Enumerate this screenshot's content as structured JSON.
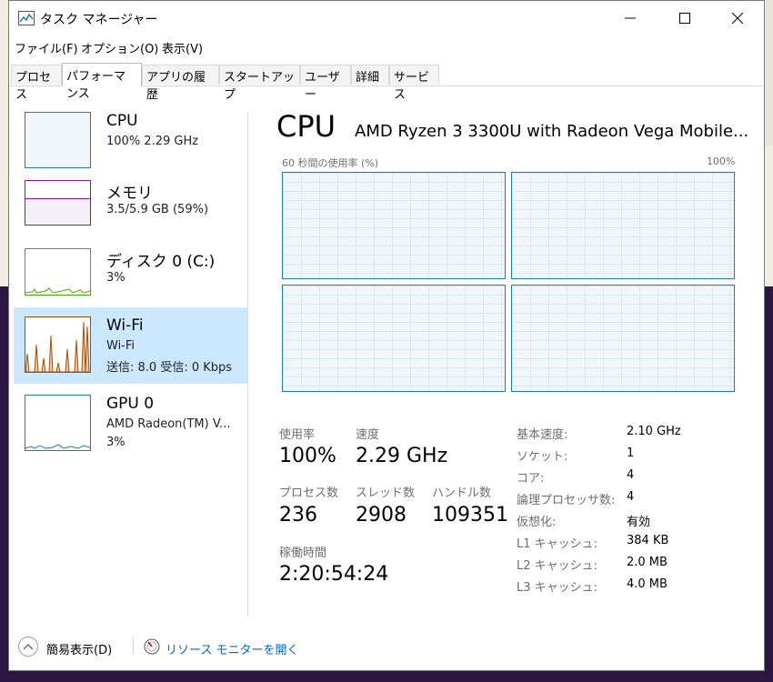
{
  "window": {
    "title": "タスク マネージャー",
    "controls": {
      "minimize": "—",
      "maximize": "☐",
      "close": "✕"
    }
  },
  "menu": [
    "ファイル(F)",
    "オプション(O)",
    "表示(V)"
  ],
  "tabs": [
    {
      "label": "プロセス",
      "active": false
    },
    {
      "label": "パフォーマンス",
      "active": true
    },
    {
      "label": "アプリの履歴",
      "active": false
    },
    {
      "label": "スタートアップ",
      "active": false
    },
    {
      "label": "ユーザー",
      "active": false
    },
    {
      "label": "詳細",
      "active": false
    },
    {
      "label": "サービス",
      "active": false
    }
  ],
  "sidebar": [
    {
      "title": "CPU",
      "line1": "100%  2.29 GHz",
      "line2": "",
      "color": "#1f7bb0",
      "selected": false
    },
    {
      "title": "メモリ",
      "line1": "3.5/5.9 GB (59%)",
      "line2": "",
      "color": "#8b12ae",
      "selected": false,
      "fill_fraction": 0.59
    },
    {
      "title": "ディスク 0 (C:)",
      "line1": "3%",
      "line2": "",
      "color": "#4da60c",
      "selected": false
    },
    {
      "title": "Wi-Fi",
      "line1": "Wi-Fi",
      "line2": "送信: 8.0  受信: 0 Kbps",
      "color": "#a74f01",
      "selected": true
    },
    {
      "title": "GPU 0",
      "line1": "AMD Radeon(TM) V...",
      "line2": "3%",
      "color": "#1f7bb0",
      "selected": false
    }
  ],
  "detail": {
    "title": "CPU",
    "cpu_name": "AMD Ryzen 3 3300U with Radeon Vega Mobile...",
    "graph_left_label": "60 秒間の使用率 (%)",
    "graph_right_label": "100%",
    "stats": {
      "usage_label": "使用率",
      "usage_value": "100%",
      "speed_label": "速度",
      "speed_value": "2.29 GHz",
      "processes_label": "プロセス数",
      "processes_value": "236",
      "threads_label": "スレッド数",
      "threads_value": "2908",
      "handles_label": "ハンドル数",
      "handles_value": "109351",
      "uptime_label": "稼働時間",
      "uptime_value": "2:20:54:24"
    },
    "specs": [
      {
        "label": "基本速度:",
        "value": "2.10 GHz"
      },
      {
        "label": "ソケット:",
        "value": "1"
      },
      {
        "label": "コア:",
        "value": "4"
      },
      {
        "label": "論理プロセッサ数:",
        "value": "4"
      },
      {
        "label": "仮想化:",
        "value": "有効"
      },
      {
        "label": "L1 キャッシュ:",
        "value": "384 KB"
      },
      {
        "label": "L2 キャッシュ:",
        "value": "2.0 MB"
      },
      {
        "label": "L3 キャッシュ:",
        "value": "4.0 MB"
      }
    ]
  },
  "footer": {
    "fewer_details": "簡易表示(D)",
    "resource_monitor": "リソース モニターを開く",
    "link_color": "#0066cc"
  }
}
